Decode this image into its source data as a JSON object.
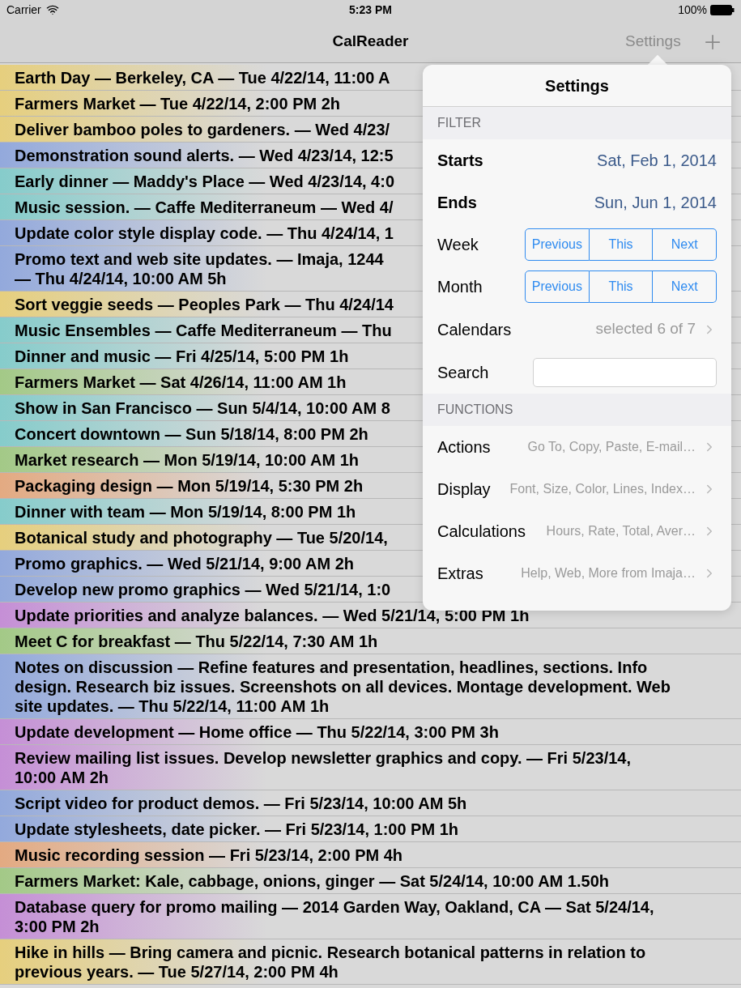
{
  "status_bar": {
    "carrier": "Carrier",
    "time": "5:23 PM",
    "battery": "100%"
  },
  "nav_bar": {
    "title": "CalReader",
    "settings_button": "Settings"
  },
  "events": [
    {
      "lines": [
        "Earth Day — Berkeley, CA — Tue 4/22/14, 11:00 A"
      ],
      "color": "#e6cf7e"
    },
    {
      "lines": [
        "Farmers Market — Tue 4/22/14, 2:00 PM 2h"
      ],
      "color": "#e6cf7e"
    },
    {
      "lines": [
        "Deliver bamboo poles to gardeners. — Wed 4/23/"
      ],
      "color": "#e6cf7e"
    },
    {
      "lines": [
        "Demonstration sound alerts. — Wed 4/23/14, 12:5"
      ],
      "color": "#93a9dc"
    },
    {
      "lines": [
        "Early dinner — Maddy's Place — Wed 4/23/14, 4:0"
      ],
      "color": "#86cccb"
    },
    {
      "lines": [
        "Music session. — Caffe Mediterraneum — Wed 4/"
      ],
      "color": "#86cccb"
    },
    {
      "lines": [
        "Update color style display code. — Thu 4/24/14, 1"
      ],
      "color": "#93a9dc"
    },
    {
      "lines": [
        "Promo text and web site updates. — Imaja, 1244",
        "— Thu 4/24/14, 10:00 AM 5h"
      ],
      "color": "#93a9dc"
    },
    {
      "lines": [
        "Sort veggie seeds — Peoples Park — Thu 4/24/14"
      ],
      "color": "#e6cf7e"
    },
    {
      "lines": [
        "Music Ensembles — Caffe Mediterraneum — Thu"
      ],
      "color": "#86cccb"
    },
    {
      "lines": [
        "Dinner and music — Fri 4/25/14, 5:00 PM 1h"
      ],
      "color": "#86cccb"
    },
    {
      "lines": [
        "Farmers Market — Sat 4/26/14, 11:00 AM 1h"
      ],
      "color": "#a3c987"
    },
    {
      "lines": [
        "Show in San Francisco — Sun 5/4/14, 10:00 AM 8"
      ],
      "color": "#86cccb"
    },
    {
      "lines": [
        "Concert downtown — Sun 5/18/14, 8:00 PM 2h"
      ],
      "color": "#86cccb"
    },
    {
      "lines": [
        "Market research — Mon 5/19/14, 10:00 AM 1h"
      ],
      "color": "#a3c987"
    },
    {
      "lines": [
        "Packaging design — Mon 5/19/14, 5:30 PM 2h"
      ],
      "color": "#e3aa82"
    },
    {
      "lines": [
        "Dinner with team — Mon 5/19/14, 8:00 PM 1h"
      ],
      "color": "#86cccb"
    },
    {
      "lines": [
        "Botanical study and photography — Tue 5/20/14,"
      ],
      "color": "#e6cf7e"
    },
    {
      "lines": [
        "Promo graphics. — Wed 5/21/14, 9:00 AM 2h"
      ],
      "color": "#93a9dc"
    },
    {
      "lines": [
        "Develop new promo graphics — Wed 5/21/14, 1:0"
      ],
      "color": "#93a9dc"
    },
    {
      "lines": [
        "Update priorities and analyze balances.  — Wed 5/21/14, 5:00 PM 1h"
      ],
      "color": "#c58fd6"
    },
    {
      "lines": [
        "Meet C for breakfast — Thu 5/22/14, 7:30 AM 1h"
      ],
      "color": "#a3c987"
    },
    {
      "lines": [
        "Notes on discussion — Refine features and presentation, headlines, sections. Info",
        "design. Research biz issues. Screenshots on all devices. Montage development. Web",
        "site updates. — Thu 5/22/14, 11:00 AM 1h"
      ],
      "color": "#93a9dc"
    },
    {
      "lines": [
        "Update development — Home office — Thu 5/22/14, 3:00 PM 3h"
      ],
      "color": "#c58fd6"
    },
    {
      "lines": [
        "Review mailing list issues. Develop newsletter graphics and copy. — Fri 5/23/14,",
        "10:00 AM 2h"
      ],
      "color": "#c58fd6"
    },
    {
      "lines": [
        "Script video for product demos. — Fri 5/23/14, 10:00 AM 5h"
      ],
      "color": "#93a9dc"
    },
    {
      "lines": [
        "Update stylesheets, date picker. — Fri 5/23/14, 1:00 PM 1h"
      ],
      "color": "#93a9dc"
    },
    {
      "lines": [
        "Music recording session — Fri 5/23/14, 2:00 PM 4h"
      ],
      "color": "#e3aa82"
    },
    {
      "lines": [
        "Farmers Market: Kale, cabbage, onions, ginger — Sat 5/24/14, 10:00 AM 1.50h"
      ],
      "color": "#a3c987"
    },
    {
      "lines": [
        "Database query for promo mailing — 2014 Garden Way, Oakland, CA — Sat 5/24/14,",
        "3:00 PM 2h"
      ],
      "color": "#c58fd6"
    },
    {
      "lines": [
        "Hike in hills — Bring camera and picnic. Research botanical patterns in relation to",
        "previous years.  — Tue 5/27/14, 2:00 PM 4h"
      ],
      "color": "#e6cf7e"
    }
  ],
  "settings_popover": {
    "title": "Settings",
    "sections": [
      {
        "header": "FILTER",
        "rows": [
          {
            "kind": "date",
            "label": "Starts",
            "value": "Sat, Feb 1, 2014"
          },
          {
            "kind": "date",
            "label": "Ends",
            "value": "Sun, Jun 1, 2014"
          },
          {
            "kind": "segments",
            "label": "Week",
            "segments": [
              "Previous",
              "This",
              "Next"
            ]
          },
          {
            "kind": "segments",
            "label": "Month",
            "segments": [
              "Previous",
              "This",
              "Next"
            ]
          },
          {
            "kind": "link",
            "label": "Calendars",
            "value": "selected 6 of 7"
          },
          {
            "kind": "search",
            "label": "Search"
          }
        ]
      },
      {
        "header": "FUNCTIONS",
        "rows": [
          {
            "kind": "menu",
            "label": "Actions",
            "value": "Go To, Copy, Paste, E-mail…"
          },
          {
            "kind": "menu",
            "label": "Display",
            "value": "Font, Size, Color, Lines, Index…"
          },
          {
            "kind": "menu",
            "label": "Calculations",
            "value": "Hours, Rate, Total, Aver…"
          },
          {
            "kind": "menu",
            "label": "Extras",
            "value": "Help, Web, More from Imaja…"
          }
        ]
      }
    ]
  }
}
